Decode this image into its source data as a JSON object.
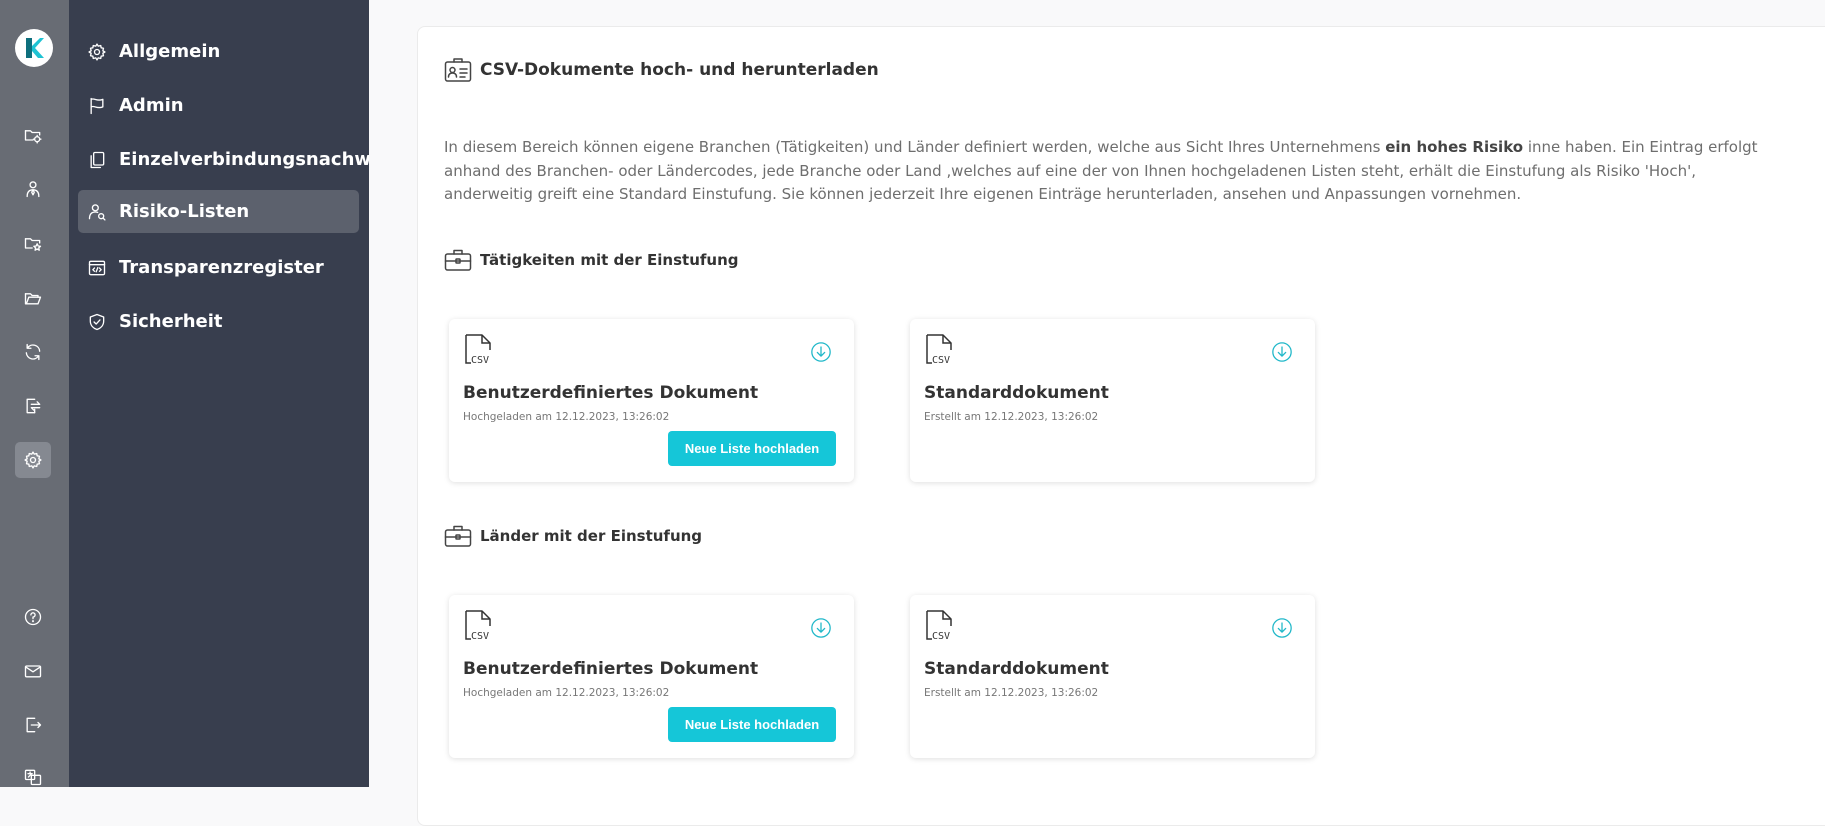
{
  "sidebar": {
    "items": [
      {
        "label": "Allgemein",
        "icon": "gear-icon"
      },
      {
        "label": "Admin",
        "icon": "flag-icon"
      },
      {
        "label": "Einzelverbindungsnachweise",
        "icon": "copy-icon"
      },
      {
        "label": "Risiko-Listen",
        "icon": "user-search-icon"
      },
      {
        "label": "Transparenzregister",
        "icon": "code-window-icon"
      },
      {
        "label": "Sicherheit",
        "icon": "shield-icon"
      }
    ],
    "active": "Risiko-Listen"
  },
  "rail": {
    "icons": [
      "folder-gear-icon",
      "user-tie-icon",
      "folder-star-icon",
      "folder-open-icon",
      "refresh-icon",
      "transfer-icon",
      "gear-icon",
      "help-icon",
      "mail-icon",
      "logout-icon",
      "language-icon"
    ],
    "active": "gear-icon"
  },
  "panel": {
    "title": "CSV-Dokumente hoch- und herunterladen",
    "intro_part1": "In diesem Bereich können eigene Branchen (Tätigkeiten) und Länder definiert werden, welche aus Sicht Ihres Unternehmens ",
    "intro_bold": "ein hohes Risiko",
    "intro_part2": " inne haben. Ein Eintrag erfolgt anhand des Branchen- oder Ländercodes, jede Branche oder Land ‚welches auf eine der von Ihnen hochgeladenen Listen steht, erhält die Einstufung als Risiko 'Hoch', anderweitig greift eine Standard Einstufung. Sie können jederzeit Ihre eigenen Einträge herunterladen, ansehen und Anpassungen vornehmen."
  },
  "sections": [
    {
      "title": "Tätigkeiten mit der Einstufung",
      "custom": {
        "title": "Benutzerdefiniertes Dokument",
        "date": "Hochgeladen am 12.12.2023, 13:26:02",
        "button": "Neue Liste hochladen"
      },
      "standard": {
        "title": "Standarddokument",
        "date": "Erstellt am 12.12.2023, 13:26:02"
      }
    },
    {
      "title": "Länder mit der Einstufung",
      "custom": {
        "title": "Benutzerdefiniertes Dokument",
        "date": "Hochgeladen am 12.12.2023, 13:26:02",
        "button": "Neue Liste hochladen"
      },
      "standard": {
        "title": "Standarddokument",
        "date": "Erstellt am 12.12.2023, 13:26:02"
      }
    }
  ],
  "colors": {
    "accent": "#15c6d8",
    "sidebar": "#383e4e",
    "rail": "#686c74",
    "logo": "#1fc3d3"
  }
}
